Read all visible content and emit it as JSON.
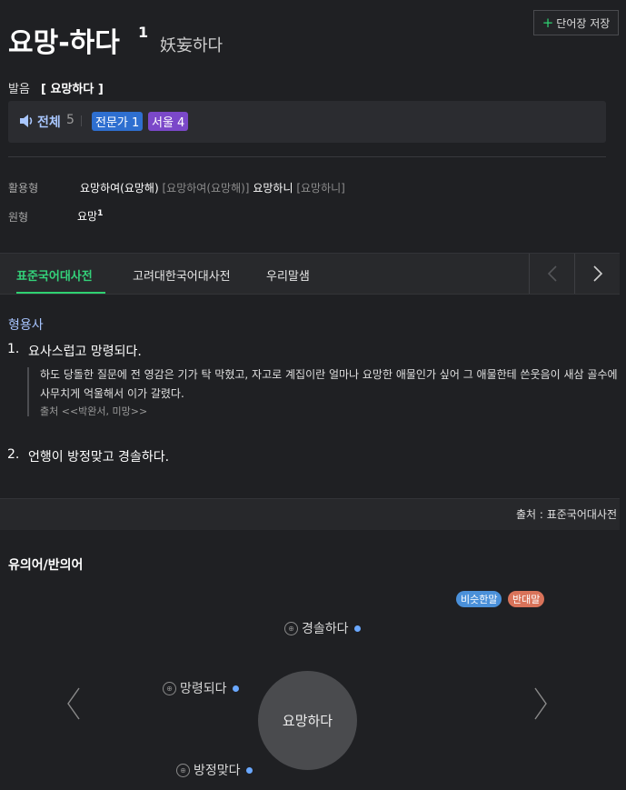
{
  "header": {
    "save_button": "단어장 저장",
    "title": "요망-하다",
    "title_sup": "1",
    "hanja": "妖妄하다"
  },
  "pronunciation": {
    "label": "발음",
    "value": "[ 요망하다 ]"
  },
  "audio": {
    "all_label": "전체",
    "all_count": "5",
    "expert_badge": "전문가 1",
    "seoul_badge": "서울 4"
  },
  "conjugation": {
    "label": "활용형",
    "form1": "요망하여(요망해)",
    "form1_pron": "[요망하여(요망해)]",
    "form2": "요망하니",
    "form2_pron": "[요망하니]"
  },
  "original": {
    "label": "원형",
    "value": "요망",
    "sup": "1"
  },
  "tabs": [
    {
      "label": "표준국어대사전"
    },
    {
      "label": "고려대한국어대사전"
    },
    {
      "label": "우리말샘"
    }
  ],
  "definitions": {
    "pos": "형용사",
    "items": [
      {
        "num": "1.",
        "text": "요사스럽고 망령되다.",
        "example": "하도 당돌한 질문에 전 영감은 기가 탁 막혔고, 자고로 계집이란 얼마나 요망한 애물인가 싶어 그 애물한테 쓴웃음이 새삼 골수에 사무치게 억울해서 이가 갈렸다.",
        "example_line1": "하도 당돌한 질문에 전 영감은 기가 탁 막혔고, 자고로 계집이란 얼마나 요망한 애물인가 싶어 그 애물한테 쓴웃음이 새삼 골수에 사무치게 억울해서 이가 갈렸다.",
        "source": "출처 <<박완서, 미망>>"
      },
      {
        "num": "2.",
        "text": "언행이 방정맞고 경솔하다."
      }
    ]
  },
  "source_footer": "출처 : 표준국어대사전",
  "synonyms": {
    "title": "유의어/반의어",
    "legend_similar": "비슷한말",
    "legend_opposite": "반대말",
    "center": "요망하다",
    "words": [
      "경솔하다",
      "망령되다",
      "방정맞다"
    ],
    "colors": {
      "similar": "#4a90d9",
      "opposite": "#d9735a"
    }
  }
}
